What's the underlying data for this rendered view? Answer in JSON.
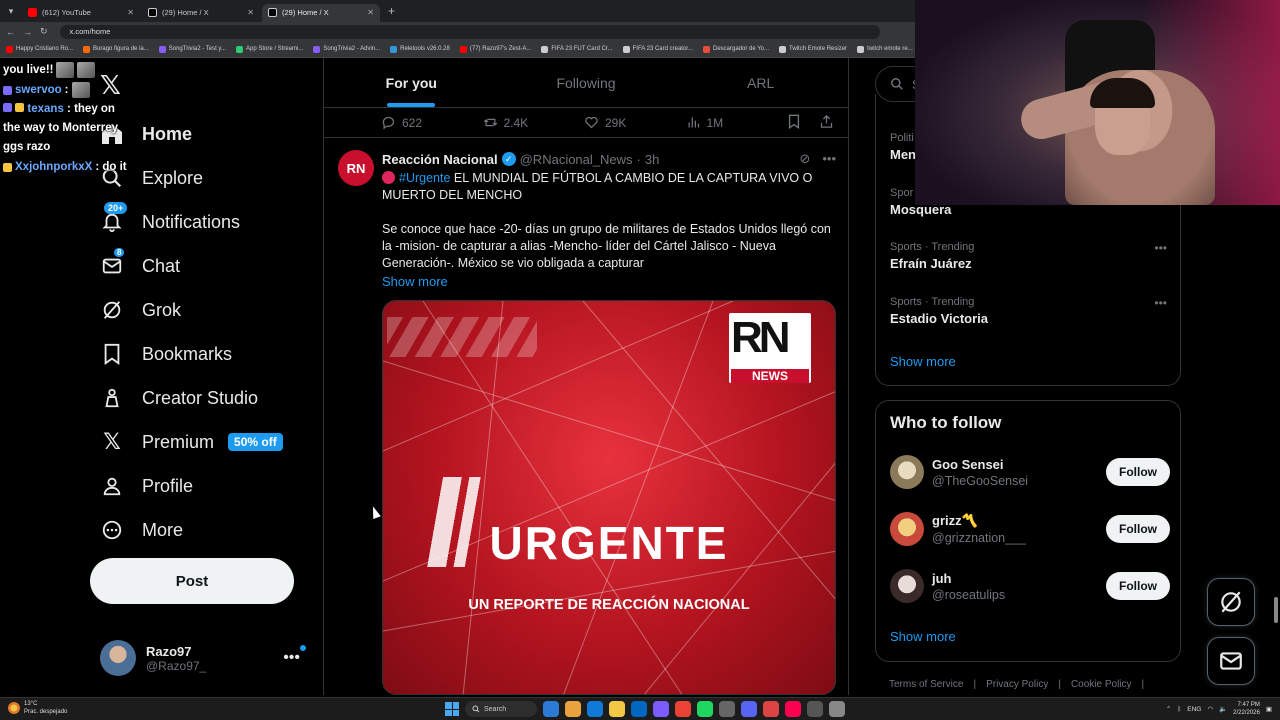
{
  "browser": {
    "tabs": [
      {
        "title": "(612) YouTube",
        "color": "#ff0000",
        "active": false
      },
      {
        "title": "(29) Home / X",
        "color": "#ffffff",
        "active": false
      },
      {
        "title": "(29) Home / X",
        "color": "#ffffff",
        "active": true
      }
    ],
    "url": "x.com/home",
    "bookmarks": [
      {
        "label": "Happy Cristiano Ro...",
        "color": "#ff0000"
      },
      {
        "label": "Burago figura de la...",
        "color": "#ff6b00"
      },
      {
        "label": "SongTrivia2 - Test y...",
        "color": "#8a5cf6"
      },
      {
        "label": "App Store / Streami...",
        "color": "#2ecc71"
      },
      {
        "label": "SongTrivia2 - Advin...",
        "color": "#8a5cf6"
      },
      {
        "label": "Reletools v26.0.28",
        "color": "#3498db"
      },
      {
        "label": "(77) Razo97's Zest-A...",
        "color": "#ff0000"
      },
      {
        "label": "FIFA 23 FUT Card Cr...",
        "color": "#cccccc"
      },
      {
        "label": "FIFA 23 Card creator...",
        "color": "#cccccc"
      },
      {
        "label": "Descargador de Yo...",
        "color": "#e74c3c"
      },
      {
        "label": "Twitch Emote Resizer",
        "color": "#cccccc"
      },
      {
        "label": "twitch emote re...",
        "color": "#cccccc"
      }
    ]
  },
  "stream_chat": [
    {
      "user": "",
      "message": "you live!!"
    },
    {
      "user": "swervoo",
      "message": ":"
    },
    {
      "user": "texans",
      "message": ": they on the way to Monterrey ggs razo"
    },
    {
      "user": "XxjohnporkxX",
      "message": ": do it"
    }
  ],
  "sidebar": {
    "items": [
      {
        "label": "Home",
        "icon": "home-icon"
      },
      {
        "label": "Explore",
        "icon": "search-icon"
      },
      {
        "label": "Notifications",
        "icon": "bell-icon",
        "badge": "20+"
      },
      {
        "label": "Chat",
        "icon": "mail-icon",
        "badge": "8"
      },
      {
        "label": "Grok",
        "icon": "grok-icon"
      },
      {
        "label": "Bookmarks",
        "icon": "bookmark-icon"
      },
      {
        "label": "Creator Studio",
        "icon": "creator-studio-icon"
      },
      {
        "label": "Premium",
        "icon": "x-icon",
        "promo": "50% off"
      },
      {
        "label": "Profile",
        "icon": "person-icon"
      },
      {
        "label": "More",
        "icon": "more-circle-icon"
      }
    ],
    "post_label": "Post",
    "account": {
      "name": "Razo97",
      "handle": "@Razo97_"
    }
  },
  "timeline": {
    "tabs": [
      "For you",
      "Following",
      "ARL"
    ],
    "prev_stats": {
      "replies": "622",
      "reposts": "2.4K",
      "likes": "29K",
      "views": "1M"
    },
    "tweet": {
      "avatar_text": "RN",
      "name": "Reacción Nacional",
      "handle": "@RNacional_News",
      "time": "3h",
      "hashtag": "#Urgente",
      "headline": " EL MUNDIAL DE FÚTBOL A CAMBIO DE LA CAPTURA VIVO O MUERTO DEL MENCHO",
      "body": "Se conoce que hace -20- días un grupo de militares de Estados Unidos llegó con la -mision- de capturar a alias -Mencho- líder del Cártel Jalisco - Nueva Generación-. México se vio obligada a capturar",
      "show_more": "Show more",
      "media": {
        "logo_big": "RN",
        "logo_small": "NEWS",
        "title": "URGENTE",
        "subtitle": "UN REPORTE DE REACCIÓN NACIONAL"
      }
    }
  },
  "right": {
    "search_placeholder": "Se",
    "trends": [
      {
        "cat": "Politi",
        "name": "Men"
      },
      {
        "cat": "Spor",
        "name": "Mosquera"
      },
      {
        "cat": "Sports · Trending",
        "name": "Efraín Juárez"
      },
      {
        "cat": "Sports · Trending",
        "name": "Estadio Victoria"
      }
    ],
    "trends_show_more": "Show more",
    "who_to_follow": {
      "title": "Who to follow",
      "users": [
        {
          "name": "Goo Sensei",
          "handle": "@TheGooSensei",
          "color": "#d8c9a3"
        },
        {
          "name": "grizz〽️",
          "handle": "@grizznation___",
          "color": "#e0b84a"
        },
        {
          "name": "juh",
          "handle": "@roseatulips",
          "color": "#d4cbc8"
        }
      ],
      "follow_label": "Follow",
      "show_more": "Show more"
    },
    "footer": [
      "Terms of Service",
      "|",
      "Privacy Policy",
      "|",
      "Cookie Policy",
      "|"
    ]
  },
  "taskbar": {
    "weather_temp": "13°C",
    "weather_desc": "Prac. despejado",
    "search_label": "Search",
    "lang": "ENG",
    "time": "7:47 PM",
    "date": "2/22/2026",
    "apps": [
      "#2b7bd6",
      "#e8a33d",
      "#0f7ad8",
      "#f2c744",
      "#0067c0",
      "#7c5cff",
      "#ea4335",
      "#1ed760",
      "#666666",
      "#5865f2",
      "#d44",
      "#ff0050",
      "#555",
      "#888"
    ]
  }
}
